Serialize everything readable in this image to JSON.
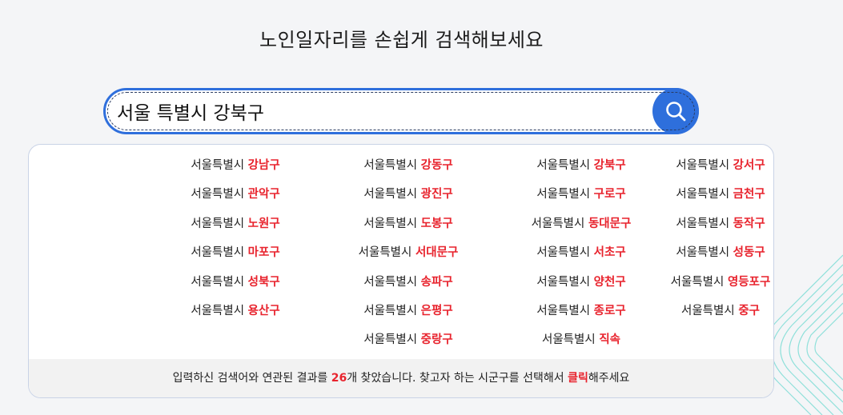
{
  "page": {
    "title": "노인일자리를 손쉽게 검색해보세요"
  },
  "search": {
    "value": "서울 특별시 강북구",
    "icon": "search-icon"
  },
  "results": {
    "prefix": "서울특별시",
    "items": [
      "강남구",
      "강동구",
      "강북구",
      "강서구",
      "관악구",
      "광진구",
      "구로구",
      "금천구",
      "노원구",
      "도봉구",
      "동대문구",
      "동작구",
      "마포구",
      "서대문구",
      "서초구",
      "성동구",
      "성북구",
      "송파구",
      "양천구",
      "영등포구",
      "용산구",
      "은평구",
      "종로구",
      "중구",
      "",
      "중랑구",
      "직속",
      ""
    ]
  },
  "footer": {
    "text_before": "입력하신 검색어와 연관된 결과를 ",
    "count": "26",
    "text_middle": "개 찾았습니다. 찾고자 하는 시군구를 선택해서 ",
    "click_word": "클릭",
    "text_after": "해주세요"
  },
  "colors": {
    "accent": "#2e6fdc",
    "highlight": "#e8232d",
    "background": "#f4f5f7",
    "decoration": "#5fd6cf"
  }
}
